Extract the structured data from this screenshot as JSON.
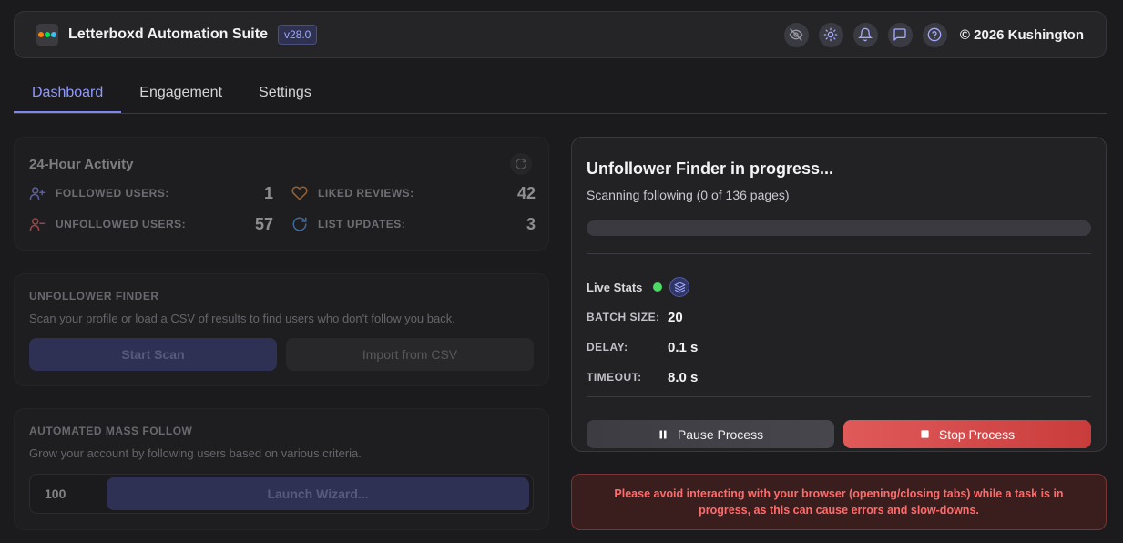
{
  "header": {
    "title": "Letterboxd Automation Suite",
    "version": "v28.0",
    "copyright": "© 2026 Kushington",
    "logo_colors": [
      "#ff8000",
      "#00e054",
      "#40bcf4"
    ],
    "icons": [
      "eye-off-icon",
      "sun-icon",
      "bell-icon",
      "chat-icon",
      "help-icon"
    ]
  },
  "tabs": [
    {
      "label": "Dashboard",
      "active": true
    },
    {
      "label": "Engagement",
      "active": false
    },
    {
      "label": "Settings",
      "active": false
    }
  ],
  "activity": {
    "title": "24-Hour Activity",
    "stats": [
      {
        "label": "FOLLOWED USERS:",
        "value": "1",
        "icon": "user-plus-icon",
        "color": "#8f98ff"
      },
      {
        "label": "LIKED REVIEWS:",
        "value": "42",
        "icon": "heart-icon",
        "color": "#ff9a3c"
      },
      {
        "label": "UNFOLLOWED USERS:",
        "value": "57",
        "icon": "user-minus-icon",
        "color": "#ff6b6b"
      },
      {
        "label": "LIST UPDATES:",
        "value": "3",
        "icon": "refresh-icon",
        "color": "#5aa9ff"
      }
    ]
  },
  "unfollower_finder": {
    "title": "UNFOLLOWER FINDER",
    "description": "Scan your profile or load a CSV of results to find users who don't follow you back.",
    "start_label": "Start Scan",
    "import_label": "Import from CSV"
  },
  "mass_follow": {
    "title": "AUTOMATED MASS FOLLOW",
    "description": "Grow your account by following users based on various criteria.",
    "quantity": "100",
    "launch_label": "Launch Wizard..."
  },
  "progress": {
    "title": "Unfollower Finder in progress...",
    "status": "Scanning following (0 of 136 pages)",
    "progress_fraction": 0,
    "live_label": "Live Stats",
    "live_color": "#4cd964",
    "settings": [
      {
        "key": "BATCH SIZE:",
        "value": "20"
      },
      {
        "key": "DELAY:",
        "value": "0.1 s"
      },
      {
        "key": "TIMEOUT:",
        "value": "8.0 s"
      }
    ],
    "pause_label": "Pause Process",
    "stop_label": "Stop Process"
  },
  "warning": {
    "text": "Please avoid interacting with your browser (opening/closing tabs) while a task is in progress, as this can cause errors and slow-downs."
  }
}
